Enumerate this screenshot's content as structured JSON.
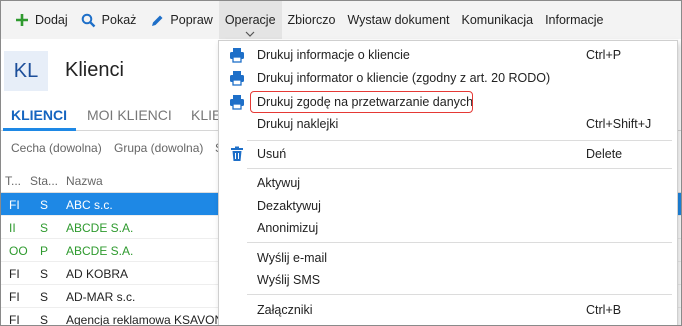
{
  "colors": {
    "accent": "#1e88e5",
    "selected_row": "#1e88e5",
    "add_green": "#2e9a2e",
    "highlight_border": "#e53935"
  },
  "toolbar": {
    "items": [
      {
        "label": "Dodaj",
        "icon": "plus-icon"
      },
      {
        "label": "Pokaż",
        "icon": "search-icon"
      },
      {
        "label": "Popraw",
        "icon": "pencil-icon"
      },
      {
        "label": "Operacje"
      },
      {
        "label": "Zbiorczo"
      },
      {
        "label": "Wystaw dokument"
      },
      {
        "label": "Komunikacja"
      },
      {
        "label": "Informacje"
      }
    ]
  },
  "header": {
    "badge": "KL",
    "title": "Klienci"
  },
  "tabs": [
    {
      "label": "KLIENCI",
      "active": true
    },
    {
      "label": "MOI KLIENCI"
    },
    {
      "label": "KLIE"
    }
  ],
  "filters": [
    "Cecha (dowolna)",
    "Grupa (dowolna)",
    "S"
  ],
  "table": {
    "headers": [
      "T...",
      "Sta...",
      "Nazwa"
    ],
    "rows": [
      {
        "t": "FI",
        "s": "S",
        "name": "ABC s.c.",
        "selected": true
      },
      {
        "t": "II",
        "s": "S",
        "name": "ABCDE S.A.",
        "green": true
      },
      {
        "t": "OO",
        "s": "P",
        "name": "ABCDE S.A.",
        "green": true
      },
      {
        "t": "FI",
        "s": "S",
        "name": "AD KOBRA"
      },
      {
        "t": "FI",
        "s": "S",
        "name": "AD-MAR s.c."
      },
      {
        "t": "FI",
        "s": "S",
        "name": "Agencja reklamowa KSAVON"
      }
    ]
  },
  "menu": {
    "items": [
      {
        "label": "Drukuj informacje o kliencie",
        "shortcut": "Ctrl+P",
        "icon": "printer-icon"
      },
      {
        "label": "Drukuj informator o kliencie (zgodny z art. 20 RODO)",
        "shortcut": "",
        "icon": "printer-icon"
      },
      {
        "label": "Drukuj zgodę na przetwarzanie danych",
        "shortcut": "",
        "icon": "printer-icon",
        "highlighted": true
      },
      {
        "label": "Drukuj naklejki",
        "shortcut": "Ctrl+Shift+J",
        "icon": ""
      },
      {
        "label": "Usuń",
        "shortcut": "Delete",
        "icon": "trash-icon"
      },
      {
        "label": "Aktywuj",
        "shortcut": ""
      },
      {
        "label": "Dezaktywuj",
        "shortcut": ""
      },
      {
        "label": "Anonimizuj",
        "shortcut": ""
      },
      {
        "label": "Wyślij e-mail",
        "shortcut": ""
      },
      {
        "label": "Wyślij SMS",
        "shortcut": ""
      },
      {
        "label": "Załączniki",
        "shortcut": "Ctrl+B"
      }
    ]
  }
}
